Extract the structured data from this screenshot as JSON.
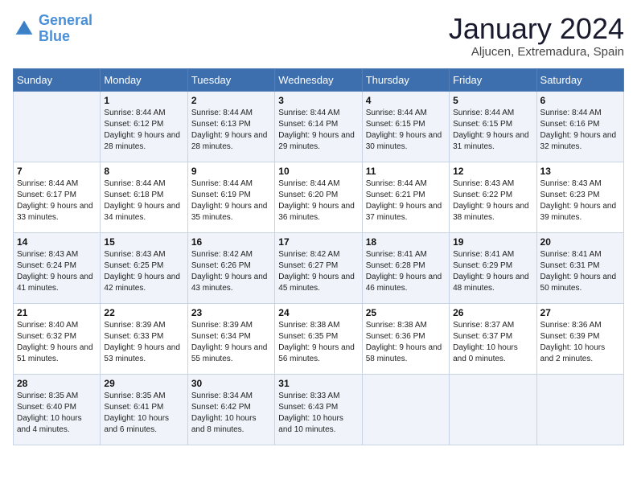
{
  "header": {
    "logo_line1": "General",
    "logo_line2": "Blue",
    "month": "January 2024",
    "location": "Aljucen, Extremadura, Spain"
  },
  "weekdays": [
    "Sunday",
    "Monday",
    "Tuesday",
    "Wednesday",
    "Thursday",
    "Friday",
    "Saturday"
  ],
  "weeks": [
    [
      {
        "day": "",
        "sunrise": "",
        "sunset": "",
        "daylight": ""
      },
      {
        "day": "1",
        "sunrise": "Sunrise: 8:44 AM",
        "sunset": "Sunset: 6:12 PM",
        "daylight": "Daylight: 9 hours and 28 minutes."
      },
      {
        "day": "2",
        "sunrise": "Sunrise: 8:44 AM",
        "sunset": "Sunset: 6:13 PM",
        "daylight": "Daylight: 9 hours and 28 minutes."
      },
      {
        "day": "3",
        "sunrise": "Sunrise: 8:44 AM",
        "sunset": "Sunset: 6:14 PM",
        "daylight": "Daylight: 9 hours and 29 minutes."
      },
      {
        "day": "4",
        "sunrise": "Sunrise: 8:44 AM",
        "sunset": "Sunset: 6:15 PM",
        "daylight": "Daylight: 9 hours and 30 minutes."
      },
      {
        "day": "5",
        "sunrise": "Sunrise: 8:44 AM",
        "sunset": "Sunset: 6:15 PM",
        "daylight": "Daylight: 9 hours and 31 minutes."
      },
      {
        "day": "6",
        "sunrise": "Sunrise: 8:44 AM",
        "sunset": "Sunset: 6:16 PM",
        "daylight": "Daylight: 9 hours and 32 minutes."
      }
    ],
    [
      {
        "day": "7",
        "sunrise": "Sunrise: 8:44 AM",
        "sunset": "Sunset: 6:17 PM",
        "daylight": "Daylight: 9 hours and 33 minutes."
      },
      {
        "day": "8",
        "sunrise": "Sunrise: 8:44 AM",
        "sunset": "Sunset: 6:18 PM",
        "daylight": "Daylight: 9 hours and 34 minutes."
      },
      {
        "day": "9",
        "sunrise": "Sunrise: 8:44 AM",
        "sunset": "Sunset: 6:19 PM",
        "daylight": "Daylight: 9 hours and 35 minutes."
      },
      {
        "day": "10",
        "sunrise": "Sunrise: 8:44 AM",
        "sunset": "Sunset: 6:20 PM",
        "daylight": "Daylight: 9 hours and 36 minutes."
      },
      {
        "day": "11",
        "sunrise": "Sunrise: 8:44 AM",
        "sunset": "Sunset: 6:21 PM",
        "daylight": "Daylight: 9 hours and 37 minutes."
      },
      {
        "day": "12",
        "sunrise": "Sunrise: 8:43 AM",
        "sunset": "Sunset: 6:22 PM",
        "daylight": "Daylight: 9 hours and 38 minutes."
      },
      {
        "day": "13",
        "sunrise": "Sunrise: 8:43 AM",
        "sunset": "Sunset: 6:23 PM",
        "daylight": "Daylight: 9 hours and 39 minutes."
      }
    ],
    [
      {
        "day": "14",
        "sunrise": "Sunrise: 8:43 AM",
        "sunset": "Sunset: 6:24 PM",
        "daylight": "Daylight: 9 hours and 41 minutes."
      },
      {
        "day": "15",
        "sunrise": "Sunrise: 8:43 AM",
        "sunset": "Sunset: 6:25 PM",
        "daylight": "Daylight: 9 hours and 42 minutes."
      },
      {
        "day": "16",
        "sunrise": "Sunrise: 8:42 AM",
        "sunset": "Sunset: 6:26 PM",
        "daylight": "Daylight: 9 hours and 43 minutes."
      },
      {
        "day": "17",
        "sunrise": "Sunrise: 8:42 AM",
        "sunset": "Sunset: 6:27 PM",
        "daylight": "Daylight: 9 hours and 45 minutes."
      },
      {
        "day": "18",
        "sunrise": "Sunrise: 8:41 AM",
        "sunset": "Sunset: 6:28 PM",
        "daylight": "Daylight: 9 hours and 46 minutes."
      },
      {
        "day": "19",
        "sunrise": "Sunrise: 8:41 AM",
        "sunset": "Sunset: 6:29 PM",
        "daylight": "Daylight: 9 hours and 48 minutes."
      },
      {
        "day": "20",
        "sunrise": "Sunrise: 8:41 AM",
        "sunset": "Sunset: 6:31 PM",
        "daylight": "Daylight: 9 hours and 50 minutes."
      }
    ],
    [
      {
        "day": "21",
        "sunrise": "Sunrise: 8:40 AM",
        "sunset": "Sunset: 6:32 PM",
        "daylight": "Daylight: 9 hours and 51 minutes."
      },
      {
        "day": "22",
        "sunrise": "Sunrise: 8:39 AM",
        "sunset": "Sunset: 6:33 PM",
        "daylight": "Daylight: 9 hours and 53 minutes."
      },
      {
        "day": "23",
        "sunrise": "Sunrise: 8:39 AM",
        "sunset": "Sunset: 6:34 PM",
        "daylight": "Daylight: 9 hours and 55 minutes."
      },
      {
        "day": "24",
        "sunrise": "Sunrise: 8:38 AM",
        "sunset": "Sunset: 6:35 PM",
        "daylight": "Daylight: 9 hours and 56 minutes."
      },
      {
        "day": "25",
        "sunrise": "Sunrise: 8:38 AM",
        "sunset": "Sunset: 6:36 PM",
        "daylight": "Daylight: 9 hours and 58 minutes."
      },
      {
        "day": "26",
        "sunrise": "Sunrise: 8:37 AM",
        "sunset": "Sunset: 6:37 PM",
        "daylight": "Daylight: 10 hours and 0 minutes."
      },
      {
        "day": "27",
        "sunrise": "Sunrise: 8:36 AM",
        "sunset": "Sunset: 6:39 PM",
        "daylight": "Daylight: 10 hours and 2 minutes."
      }
    ],
    [
      {
        "day": "28",
        "sunrise": "Sunrise: 8:35 AM",
        "sunset": "Sunset: 6:40 PM",
        "daylight": "Daylight: 10 hours and 4 minutes."
      },
      {
        "day": "29",
        "sunrise": "Sunrise: 8:35 AM",
        "sunset": "Sunset: 6:41 PM",
        "daylight": "Daylight: 10 hours and 6 minutes."
      },
      {
        "day": "30",
        "sunrise": "Sunrise: 8:34 AM",
        "sunset": "Sunset: 6:42 PM",
        "daylight": "Daylight: 10 hours and 8 minutes."
      },
      {
        "day": "31",
        "sunrise": "Sunrise: 8:33 AM",
        "sunset": "Sunset: 6:43 PM",
        "daylight": "Daylight: 10 hours and 10 minutes."
      },
      {
        "day": "",
        "sunrise": "",
        "sunset": "",
        "daylight": ""
      },
      {
        "day": "",
        "sunrise": "",
        "sunset": "",
        "daylight": ""
      },
      {
        "day": "",
        "sunrise": "",
        "sunset": "",
        "daylight": ""
      }
    ]
  ]
}
